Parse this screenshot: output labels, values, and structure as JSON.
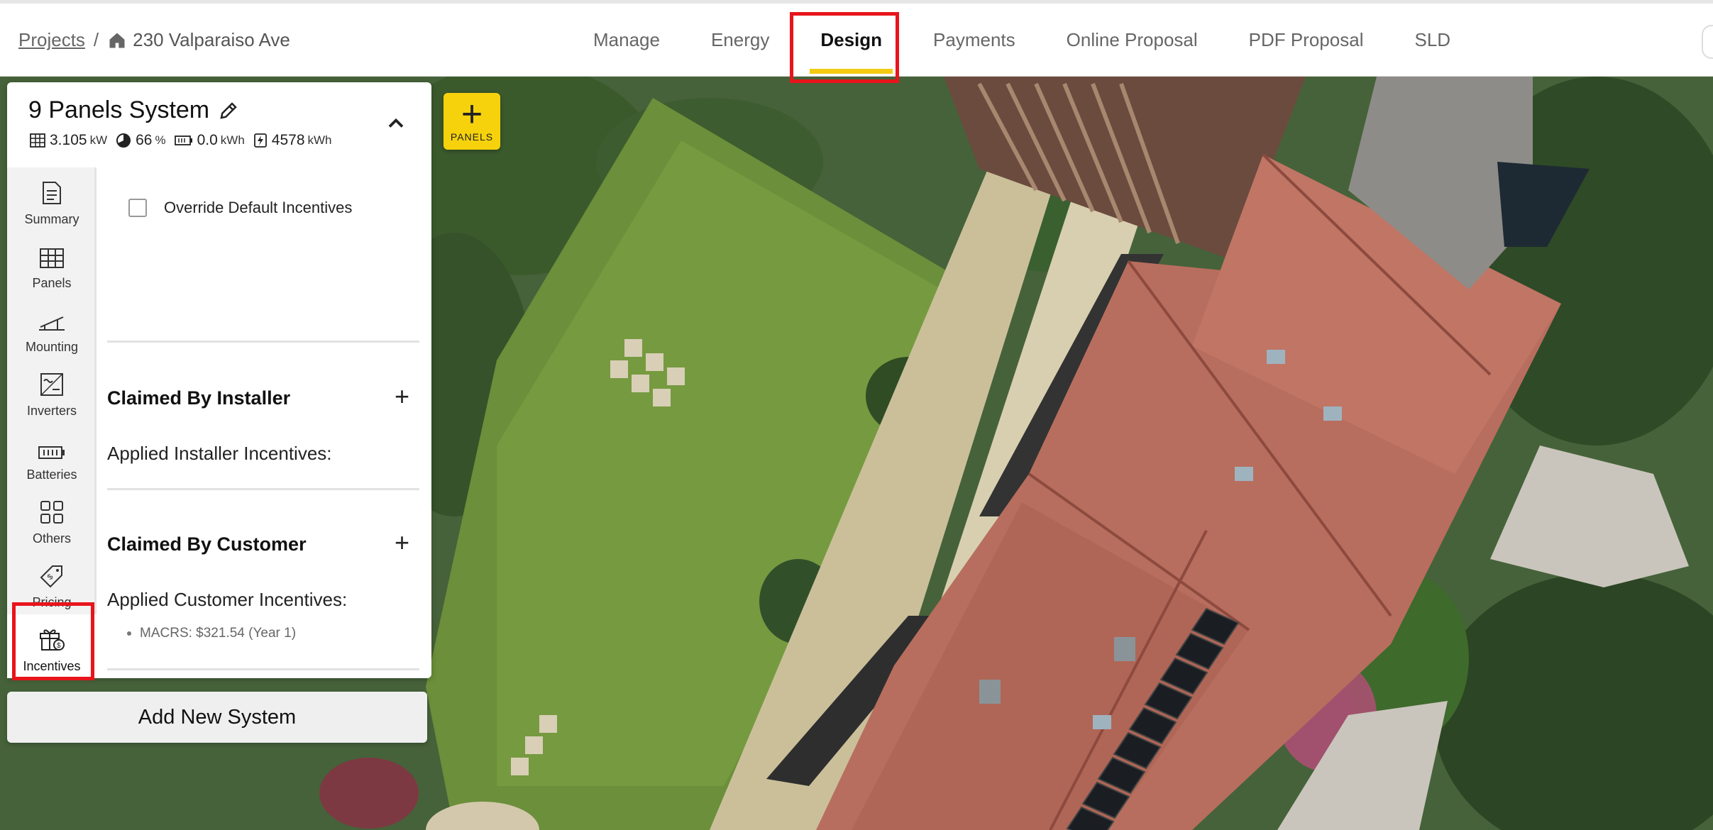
{
  "breadcrumb": {
    "root_label": "Projects",
    "separator": "/",
    "address": "230 Valparaiso Ave"
  },
  "nav": {
    "tabs": [
      {
        "label": "Manage",
        "active": false
      },
      {
        "label": "Energy",
        "active": false
      },
      {
        "label": "Design",
        "active": true
      },
      {
        "label": "Payments",
        "active": false
      },
      {
        "label": "Online Proposal",
        "active": false
      },
      {
        "label": "PDF Proposal",
        "active": false
      },
      {
        "label": "SLD",
        "active": false
      }
    ]
  },
  "add_panels_button": {
    "icon": "plus-icon",
    "label": "PANELS"
  },
  "system": {
    "title": "9 Panels System",
    "stats": {
      "size_value": "3.105",
      "size_unit": "kW",
      "offset_value": "66",
      "offset_unit": "%",
      "battery_value": "0.0",
      "battery_unit": "kWh",
      "production_value": "4578",
      "production_unit": "kWh"
    }
  },
  "sidebar": {
    "items": [
      {
        "label": "Summary",
        "icon": "document-icon"
      },
      {
        "label": "Panels",
        "icon": "grid-icon"
      },
      {
        "label": "Mounting",
        "icon": "mounting-icon"
      },
      {
        "label": "Inverters",
        "icon": "inverter-icon"
      },
      {
        "label": "Batteries",
        "icon": "battery-icon"
      },
      {
        "label": "Others",
        "icon": "others-icon"
      },
      {
        "label": "Pricing",
        "icon": "price-tag-icon"
      },
      {
        "label": "Incentives",
        "icon": "gift-icon",
        "active": true
      }
    ]
  },
  "incentives": {
    "override_label": "Override Default Incentives",
    "override_checked": false,
    "installer_title": "Claimed By Installer",
    "installer_applied": "Applied Installer Incentives:",
    "customer_title": "Claimed By Customer",
    "customer_applied": "Applied Customer Incentives:",
    "customer_items": [
      "MACRS: $321.54 (Year 1)"
    ]
  },
  "add_system_label": "Add New System",
  "colors": {
    "accent": "#f3cb12",
    "highlight": "#e8141b"
  }
}
